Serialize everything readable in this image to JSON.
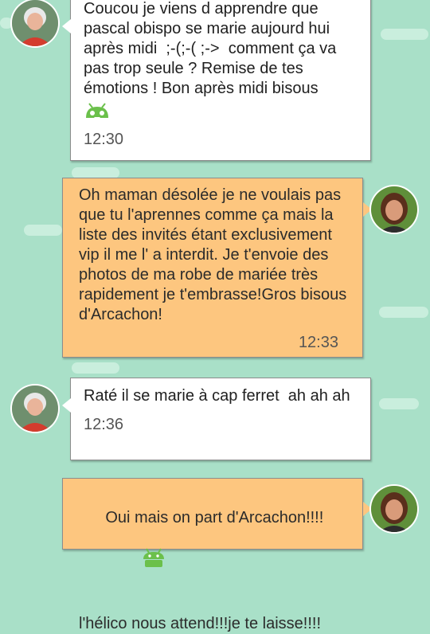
{
  "theme": {
    "background": "#a9e0c8",
    "incoming_bubble": "#ffffff",
    "outgoing_bubble": "#fdc67f",
    "emoji_green": "#6bc04b"
  },
  "messages": [
    {
      "direction": "incoming",
      "sender_avatar": "older-woman-avatar",
      "text": "Coucou je viens d apprendre que pascal obispo se marie aujourd hui après midi  ;-(;-( ;->  comment ça va pas trop seule ? Remise de tes émotions ! Bon après midi bisous",
      "emoji": "android-robot-icon",
      "time": "12:30"
    },
    {
      "direction": "outgoing",
      "sender_avatar": "young-woman-avatar",
      "text": "Oh maman désolée je ne voulais pas que tu l'aprennes comme ça mais la liste des invités étant exclusivement vip il me l' a interdit. Je t'envoie des photos de ma robe de mariée très rapidement je t'embrasse!Gros bisous d'Arcachon!",
      "time": "12:33"
    },
    {
      "direction": "incoming",
      "sender_avatar": "older-woman-avatar",
      "text": "Raté il se marie à cap ferret  ah ah ah",
      "time": "12:36"
    },
    {
      "direction": "outgoing",
      "sender_avatar": "young-woman-avatar",
      "text": "Oui mais on part d'Arcachon!!!!",
      "text_line2": "l'hélico nous attend!!!je te laisse!!!!",
      "emoji": "android-robot-icon"
    }
  ]
}
